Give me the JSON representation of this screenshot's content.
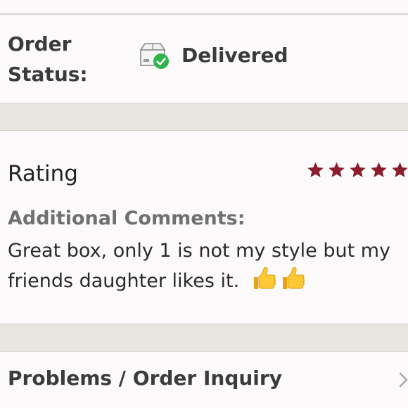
{
  "order": {
    "label": "Order\nStatus:",
    "status": "Delivered",
    "status_icon": "box-delivered-icon",
    "status_check_color": "#2fb34a"
  },
  "rating": {
    "title": "Rating",
    "stars": 5,
    "star_color": "#8b1e2c",
    "comments_label": "Additional Comments:",
    "comment": "Great box, only 1 is not my style but my friends daughter likes it.",
    "comment_emoji": "thumbs-up-icon"
  },
  "problems": {
    "label": "Problems / Order Inquiry",
    "chevron_icon": "chevron-right-icon"
  }
}
